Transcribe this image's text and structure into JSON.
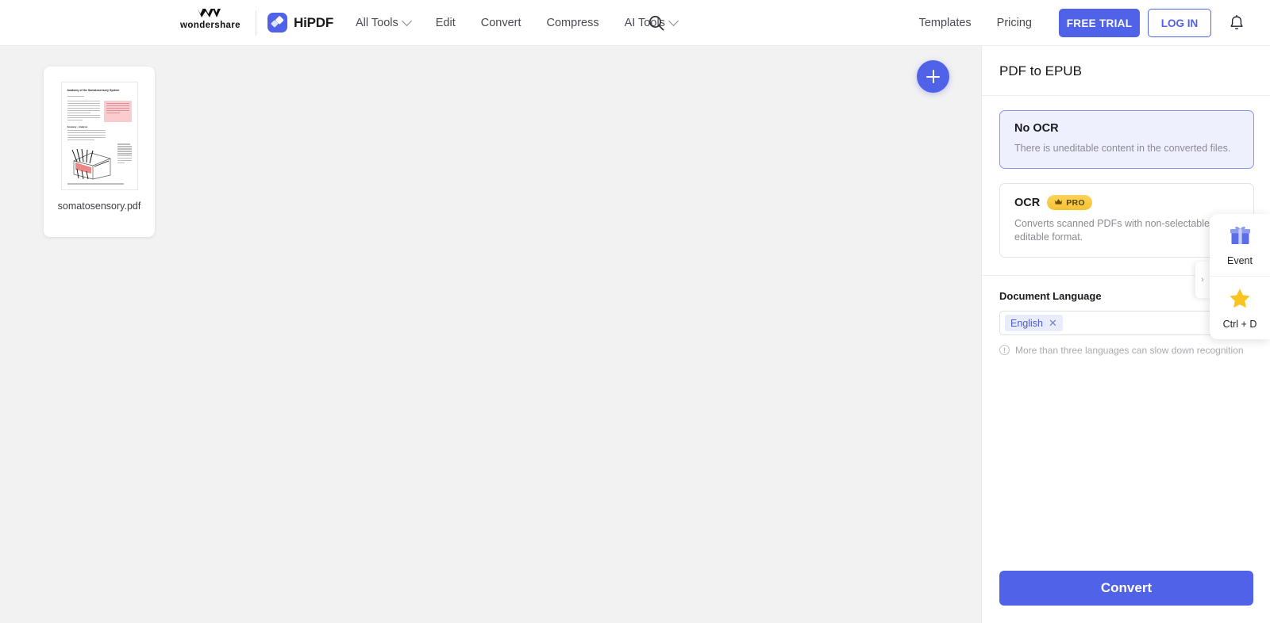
{
  "header": {
    "brand": "wondershare",
    "brand_logo_icon": "wondershare-w-logo",
    "product": "HiPDF",
    "product_icon": "hipdf-diamond-icon",
    "nav": [
      {
        "label": "All Tools",
        "has_chevron": true
      },
      {
        "label": "Edit",
        "has_chevron": false
      },
      {
        "label": "Convert",
        "has_chevron": false
      },
      {
        "label": "Compress",
        "has_chevron": false
      },
      {
        "label": "AI Tools",
        "has_chevron": true
      }
    ],
    "search_icon": "search-icon",
    "links": [
      {
        "label": "Templates"
      },
      {
        "label": "Pricing"
      }
    ],
    "free_trial": "FREE TRIAL",
    "log_in": "LOG IN",
    "bell_icon": "bell-icon"
  },
  "workspace": {
    "file": {
      "name": "somatosensory.pdf",
      "thumbnail_title": "Anatomy of the Somatosensory System",
      "thumbnail_section": "Anatomy - Analysis"
    },
    "add_file_button": "+"
  },
  "panel": {
    "title": "PDF to EPUB",
    "options": [
      {
        "title": "No OCR",
        "description": "There is uneditable content in the converted files.",
        "selected": true,
        "pro": false
      },
      {
        "title": "OCR",
        "description": "Converts scanned PDFs with non-selectable text to editable format.",
        "selected": false,
        "pro": true,
        "pro_label": "PRO",
        "pro_icon": "crown-icon"
      }
    ],
    "language": {
      "label": "Document Language",
      "selected_tags": [
        "English"
      ],
      "remove_icon": "close-x-icon",
      "expand_icon": "chevron-right-icon",
      "hint": "More than three languages can slow down recognition",
      "hint_icon": "info-icon"
    },
    "convert_button": "Convert"
  },
  "widget": {
    "items": [
      {
        "label": "Event",
        "icon": "gift-icon"
      },
      {
        "label": "Ctrl + D",
        "icon": "star-icon"
      }
    ],
    "handle_icon": "chevron-right-icon"
  },
  "colors": {
    "accent": "#4f62e8",
    "selected_card_bg": "#eef0fd",
    "selected_card_border": "#8b94ef",
    "pro_gold": "#f5c233",
    "workspace_bg": "#f2f2f2",
    "star_gold": "#f7c51e"
  }
}
